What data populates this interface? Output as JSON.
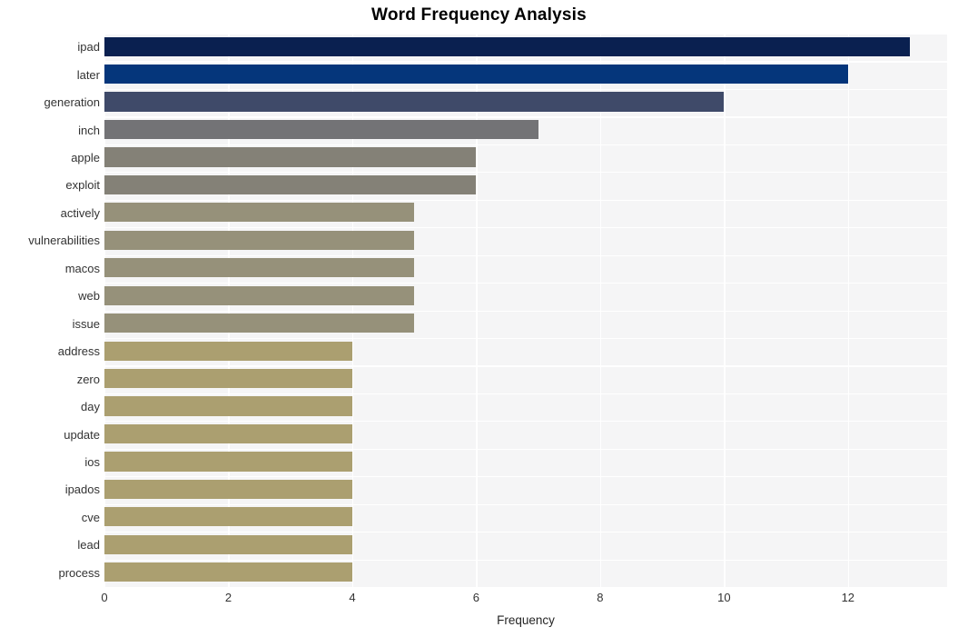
{
  "chart_data": {
    "type": "bar",
    "orientation": "horizontal",
    "title": "Word Frequency Analysis",
    "xlabel": "Frequency",
    "ylabel": "",
    "xlim": [
      0,
      13.6
    ],
    "ylim": [
      0,
      20
    ],
    "grid": true,
    "legend": null,
    "xticks": [
      0,
      2,
      4,
      6,
      8,
      10,
      12
    ],
    "xtick_labels": [
      "0",
      "2",
      "4",
      "6",
      "8",
      "10",
      "12"
    ],
    "categories": [
      "ipad",
      "later",
      "generation",
      "inch",
      "apple",
      "exploit",
      "actively",
      "vulnerabilities",
      "macos",
      "web",
      "issue",
      "address",
      "zero",
      "day",
      "update",
      "ios",
      "ipados",
      "cve",
      "lead",
      "process"
    ],
    "values": [
      13,
      12,
      10,
      7,
      6,
      6,
      5,
      5,
      5,
      5,
      5,
      4,
      4,
      4,
      4,
      4,
      4,
      4,
      4,
      4
    ],
    "bar_colors": [
      "#0a2050",
      "#05367b",
      "#3f4a69",
      "#737376",
      "#848177",
      "#848177",
      "#96917a",
      "#96917a",
      "#96917a",
      "#96917a",
      "#96917a",
      "#ab9f70",
      "#ab9f70",
      "#ab9f70",
      "#ab9f70",
      "#ab9f70",
      "#ab9f70",
      "#ab9f70",
      "#ab9f70",
      "#ab9f70"
    ]
  },
  "style": {
    "plot_background": "#f5f5f6",
    "grid_color": "#ffffff",
    "figure_background": "#ffffff",
    "tick_label_color": "#333333",
    "title_color": "#000000"
  }
}
